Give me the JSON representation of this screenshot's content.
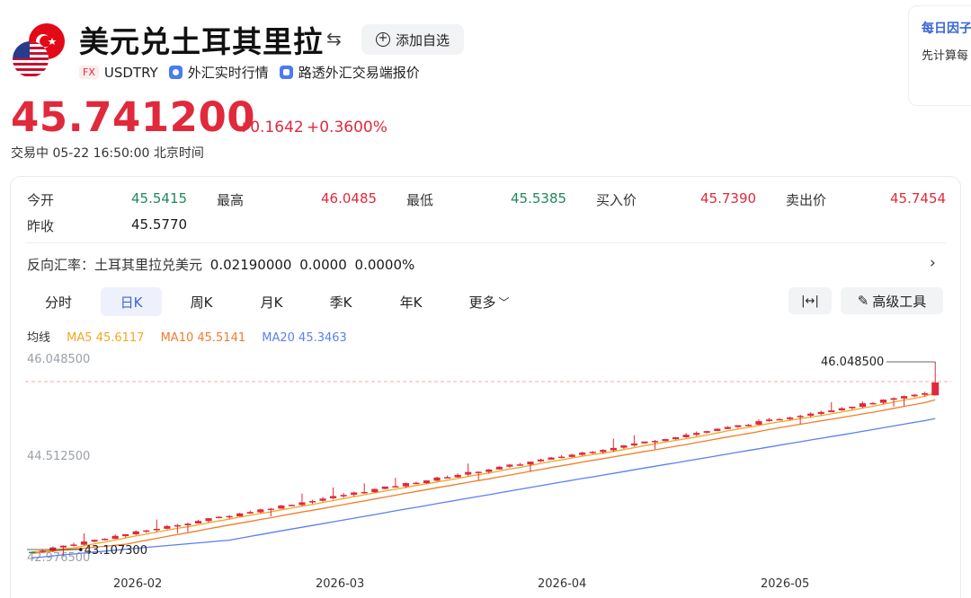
{
  "header": {
    "title": "美元兑土耳其里拉",
    "swap_icon": "⇆",
    "add_watchlist_label": "添加自选",
    "fx_tag": "FX",
    "symbol": "USDTRY",
    "link1_label": "外汇实时行情",
    "link2_label": "路透外汇交易端报价"
  },
  "quote": {
    "price": "45.741200",
    "change": "+0.1642",
    "change_percent": "+0.3600%",
    "status": "交易中  05-22 16:50:00 北京时间"
  },
  "side_card": {
    "title": "每日因子",
    "text": "先计算每"
  },
  "stats": {
    "open_label": "今开",
    "open": "45.5415",
    "high_label": "最高",
    "high": "46.0485",
    "low_label": "最低",
    "low": "45.5385",
    "bid_label": "买入价",
    "bid": "45.7390",
    "ask_label": "卖出价",
    "ask": "45.7454",
    "prev_close_label": "昨收",
    "prev_close": "45.5770"
  },
  "reverse_rate": {
    "label": "反向汇率：土耳其里拉兑美元",
    "value": "0.02190000",
    "change": "0.0000",
    "change_percent": "0.0000%"
  },
  "tabs": [
    "分时",
    "日K",
    "周K",
    "月K",
    "季K",
    "年K",
    "更多"
  ],
  "active_tab": "日K",
  "tools": {
    "fit_icon": "|↔|",
    "advanced_label": "高级工具"
  },
  "ma_legend": {
    "label": "均线",
    "ma5": "MA5 45.6117",
    "ma10": "MA10 45.5141",
    "ma20": "MA20 45.3463"
  },
  "colors": {
    "up": "#e0293b",
    "down": "#1e8a5c",
    "ma5": "#f5a623",
    "ma10": "#f07d2e",
    "ma20": "#5b7ff0",
    "accent": "#3a66d8"
  },
  "chart_data": {
    "type": "candlestick",
    "y_ticks": [
      "46.048500",
      "44.512500",
      "42.976500"
    ],
    "x_ticks": [
      "2026-02",
      "2026-03",
      "2026-04",
      "2026-05"
    ],
    "max_label": "46.048500",
    "min_label": "43.107300",
    "ylim": [
      42.9765,
      46.0485
    ],
    "last_close": 45.7412,
    "last_open": 45.5415,
    "last_high": 46.0485,
    "last_low": 45.5385,
    "start_value": 43.1073,
    "trading_days": 88
  }
}
